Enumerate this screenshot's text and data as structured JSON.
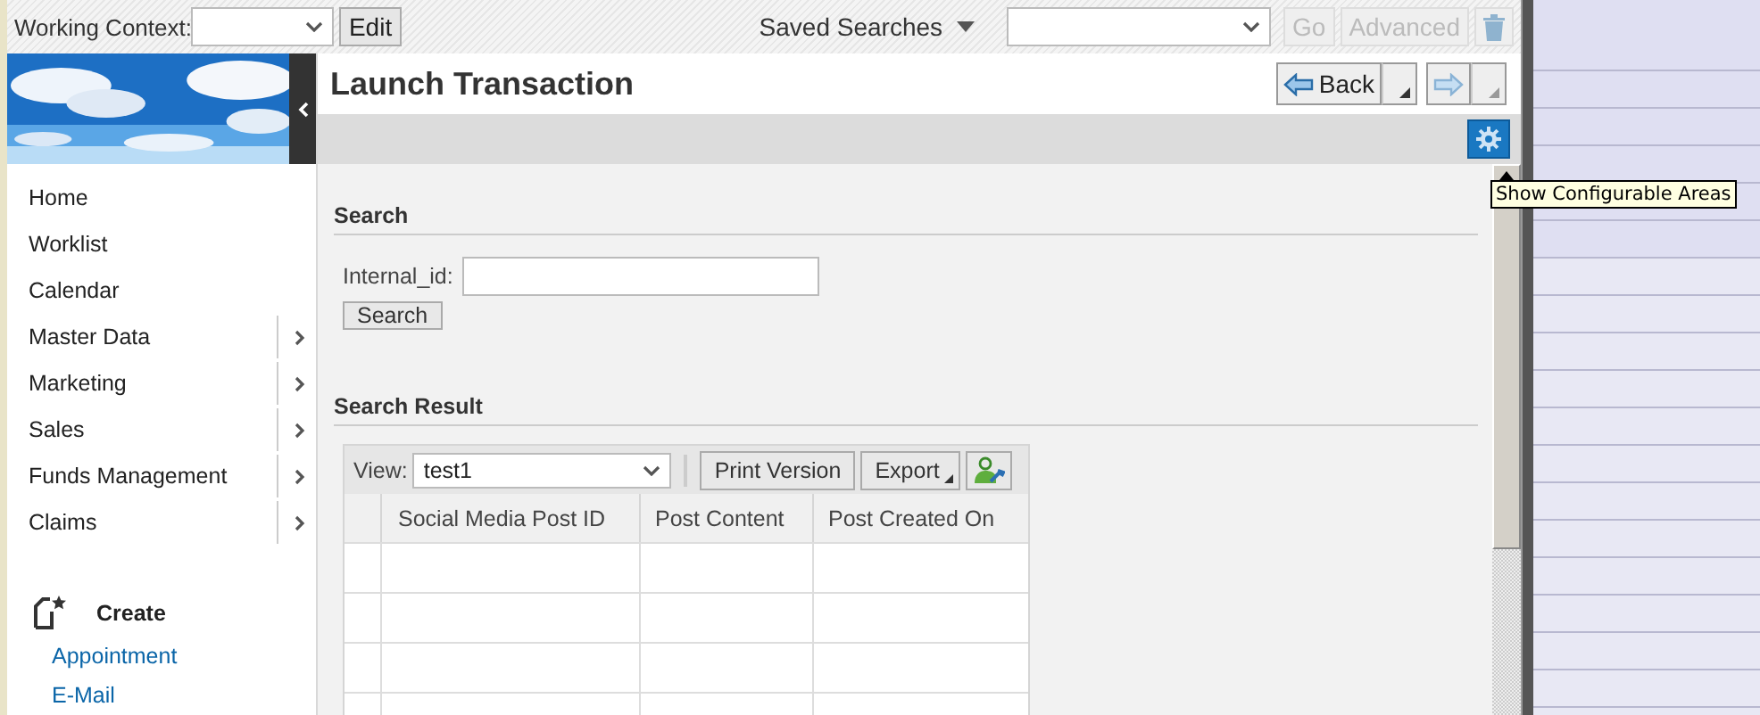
{
  "top_bar": {
    "working_context_label": "Working Context:",
    "edit_button": "Edit",
    "saved_searches_label": "Saved Searches",
    "go_button": "Go",
    "advanced_button": "Advanced",
    "go_disabled": true,
    "advanced_disabled": true
  },
  "header": {
    "title": "Launch Transaction",
    "back_button": "Back"
  },
  "tooltip": "Show Configurable Areas",
  "sidebar": {
    "items": [
      {
        "label": "Home",
        "has_submenu": false
      },
      {
        "label": "Worklist",
        "has_submenu": false
      },
      {
        "label": "Calendar",
        "has_submenu": false
      },
      {
        "label": "Master Data",
        "has_submenu": true
      },
      {
        "label": "Marketing",
        "has_submenu": true
      },
      {
        "label": "Sales",
        "has_submenu": true
      },
      {
        "label": "Funds Management",
        "has_submenu": true
      },
      {
        "label": "Claims",
        "has_submenu": true
      }
    ],
    "create": {
      "title": "Create",
      "links": [
        "Appointment",
        "E-Mail"
      ]
    }
  },
  "search": {
    "title": "Search",
    "field_label": "Internal_id:",
    "button": "Search"
  },
  "result": {
    "title": "Search Result",
    "view_label": "View:",
    "view_value": "test1",
    "print_button": "Print Version",
    "export_button": "Export",
    "columns": [
      "Social Media Post ID",
      "Post Content",
      "Post Created On"
    ]
  }
}
